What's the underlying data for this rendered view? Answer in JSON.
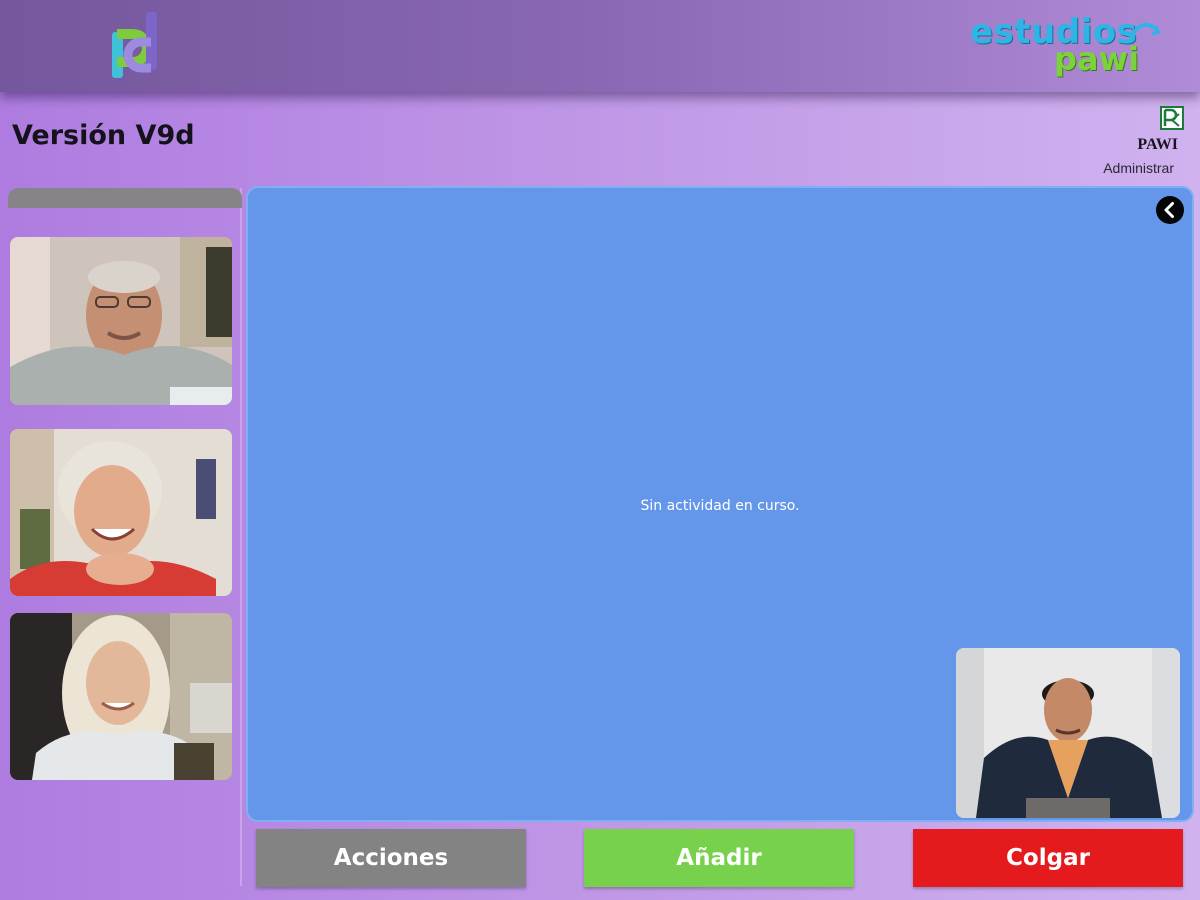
{
  "header": {
    "logo_icon": "pd-logo-icon",
    "brand_line1": "estudios",
    "brand_line2": "pawi",
    "colors": {
      "bar_start": "#74579c",
      "bar_end": "#b08bd8",
      "brand_blue": "#2fb4e6",
      "brand_green": "#7cd23a"
    }
  },
  "title": "Versión V9d",
  "user": {
    "icon": "user-badge-icon",
    "name": "PAWI",
    "role_link": "Administrar"
  },
  "participants": [
    {
      "icon": "participant-photo-1"
    },
    {
      "icon": "participant-photo-2"
    },
    {
      "icon": "participant-photo-3"
    }
  ],
  "stage": {
    "message": "Sin actividad en curso.",
    "background": "#6496ea",
    "collapse_icon": "chevron-left-circle-icon",
    "self_view_icon": "self-camera-photo"
  },
  "actions": {
    "acciones": {
      "label": "Acciones",
      "color": "#838383"
    },
    "anadir": {
      "label": "Añadir",
      "color": "#78d14c"
    },
    "colgar": {
      "label": "Colgar",
      "color": "#e41a1d"
    }
  }
}
